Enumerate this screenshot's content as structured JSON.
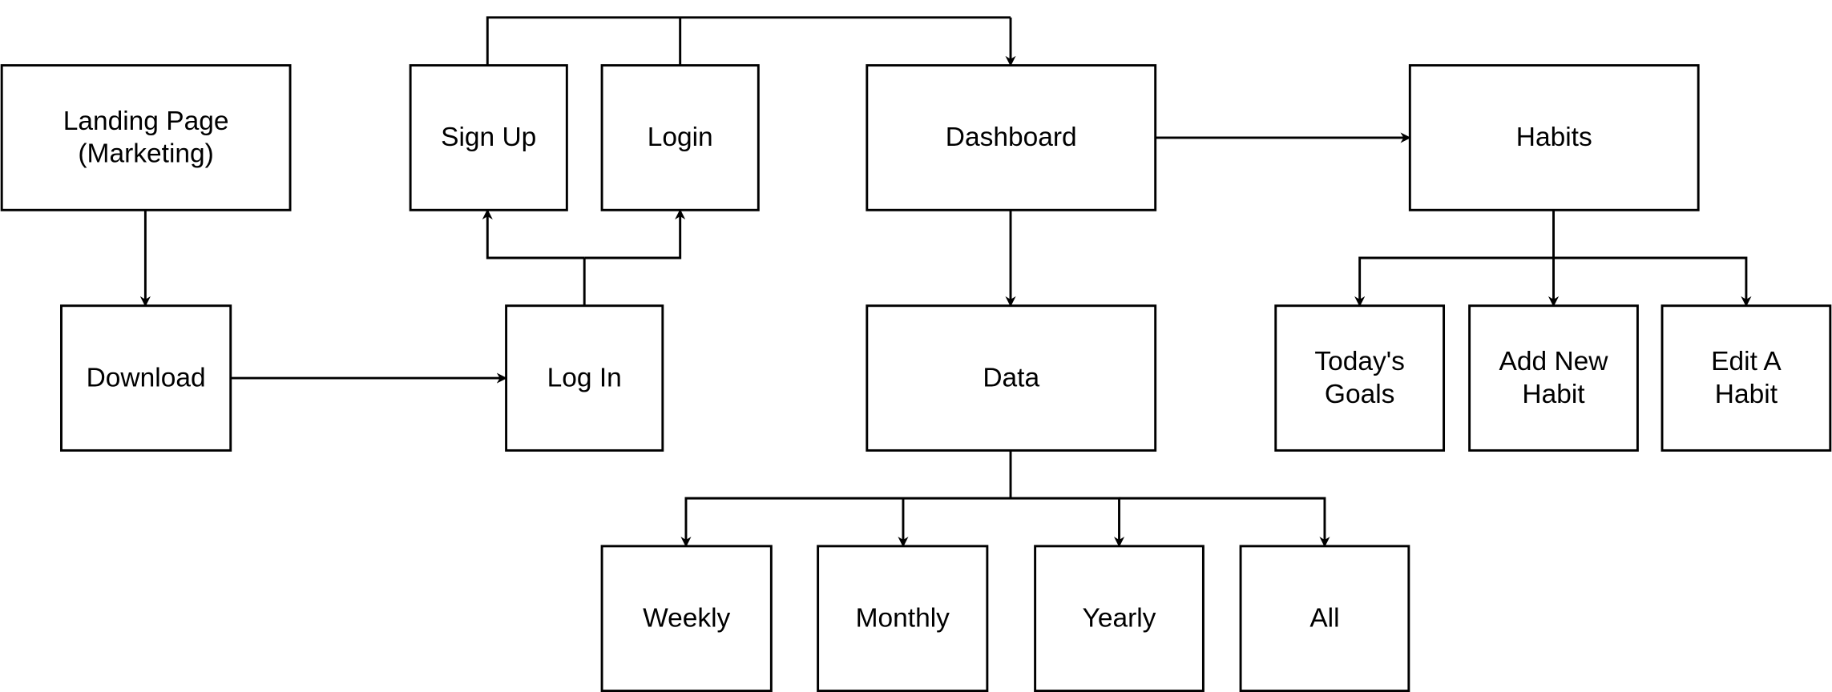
{
  "nodes": {
    "landing": [
      "Landing Page",
      "(Marketing)"
    ],
    "sign_up": [
      "Sign Up"
    ],
    "login": [
      "Login"
    ],
    "dashboard": [
      "Dashboard"
    ],
    "habits": [
      "Habits"
    ],
    "download": [
      "Download"
    ],
    "log_in": [
      "Log In"
    ],
    "data": [
      "Data"
    ],
    "todays_goals": [
      "Today's",
      "Goals"
    ],
    "add_new_habit": [
      "Add New",
      "Habit"
    ],
    "edit_a_habit": [
      "Edit A",
      "Habit"
    ],
    "weekly": [
      "Weekly"
    ],
    "monthly": [
      "Monthly"
    ],
    "yearly": [
      "Yearly"
    ],
    "all": [
      "All"
    ]
  },
  "colors": {
    "stroke": "#000000",
    "background": "#ffffff"
  }
}
